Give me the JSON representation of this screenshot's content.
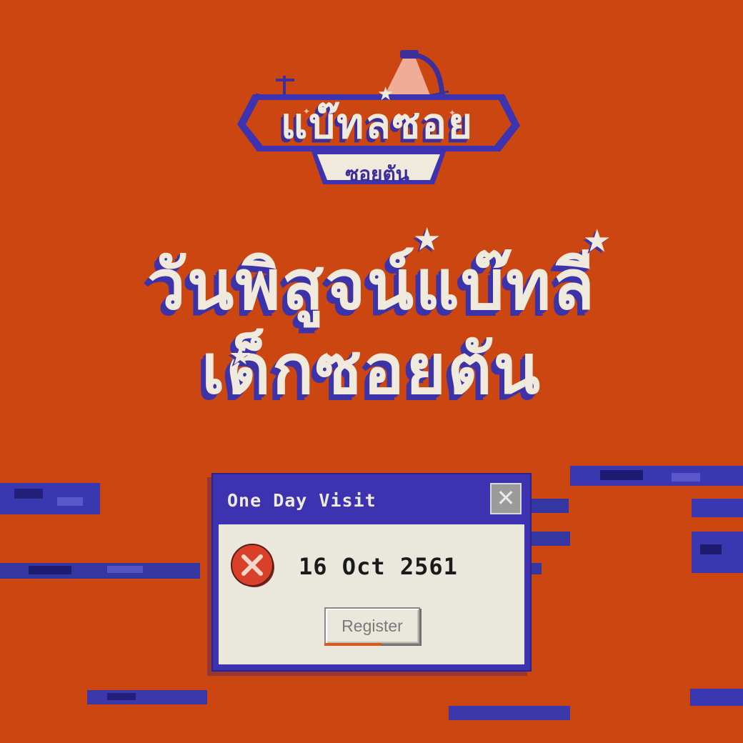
{
  "brand": {
    "logo_title": "แบ๊ทลซอย",
    "logo_subtitle": "ซอยตัน"
  },
  "headline": {
    "line1": "วันพิสูจน์แบ๊ทลี",
    "line2": "เด็กซอยตัน"
  },
  "dialog": {
    "title": "One Day Visit",
    "close_label": "✕",
    "date_text": "16 Oct 2561",
    "register_label": "Register"
  },
  "icons": {
    "close": "close-icon",
    "error": "error-icon",
    "star": "star-icon",
    "street_lamp": "street-lamp-icon"
  },
  "colors": {
    "background": "#cc4612",
    "accent_blue": "#3d33b0",
    "cream": "#efeadb",
    "error_red": "#d9402a"
  }
}
